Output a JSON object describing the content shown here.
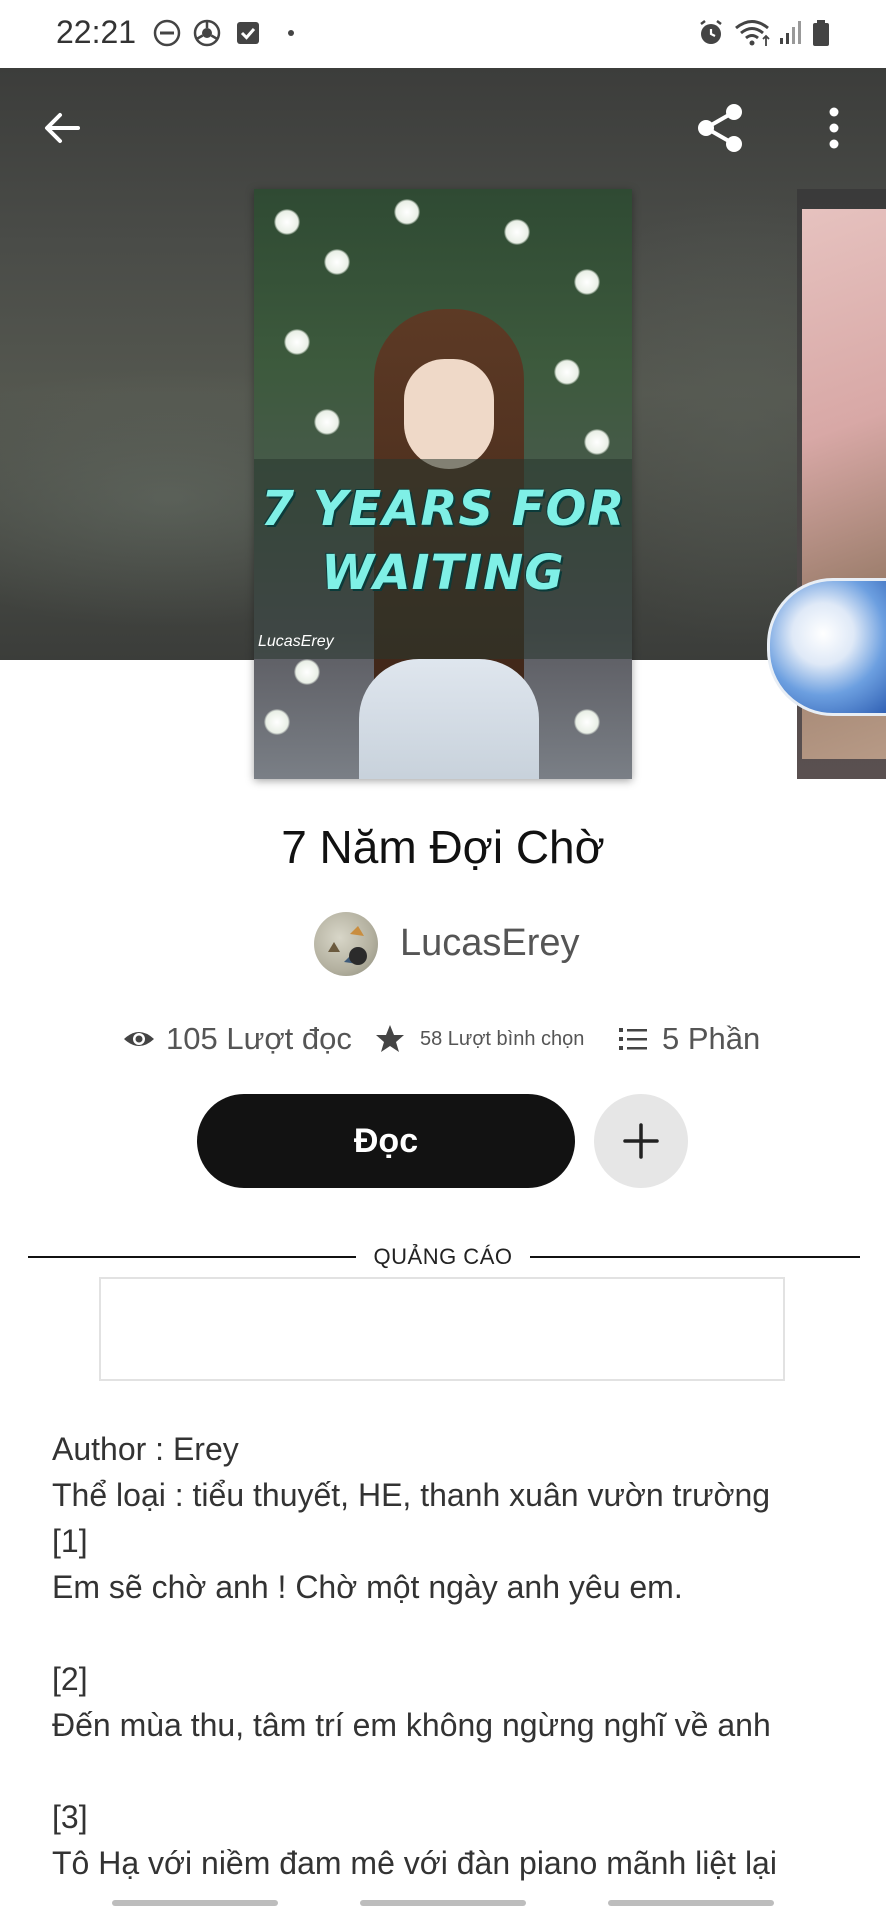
{
  "status_bar": {
    "time": "22:21",
    "left_icons": [
      "do-not-disturb-icon",
      "chrome-icon",
      "checkbox-icon",
      "dot-icon"
    ],
    "right_icons": [
      "alarm-icon",
      "wifi-icon",
      "signal-icon",
      "battery-icon"
    ]
  },
  "top_bar": {
    "back_icon": "arrow-left-icon",
    "share_icon": "share-icon",
    "more_icon": "more-vert-icon"
  },
  "cover": {
    "title_text": "7 YEARS FOR WAITING",
    "author_text": "LucasErey"
  },
  "story": {
    "title": "7 Năm Đợi Chờ",
    "author": "LucasErey"
  },
  "stats": {
    "reads": "105 Lượt đọc",
    "votes": "58 Lượt bình chọn",
    "parts": "5 Phần"
  },
  "actions": {
    "read_label": "Đọc",
    "add_icon": "plus-icon"
  },
  "ad": {
    "label": "QUẢNG CÁO"
  },
  "description": "Author : Erey\nThể loại : tiểu thuyết, HE, thanh xuân vườn trường\n[1]\nEm sẽ chờ anh ! Chờ một ngày anh yêu em.\n\n[2]\nĐến mùa thu, tâm trí em không ngừng nghĩ về anh\n\n[3]\nTô Hạ với niềm đam mê với đàn piano mãnh liệt lại"
}
